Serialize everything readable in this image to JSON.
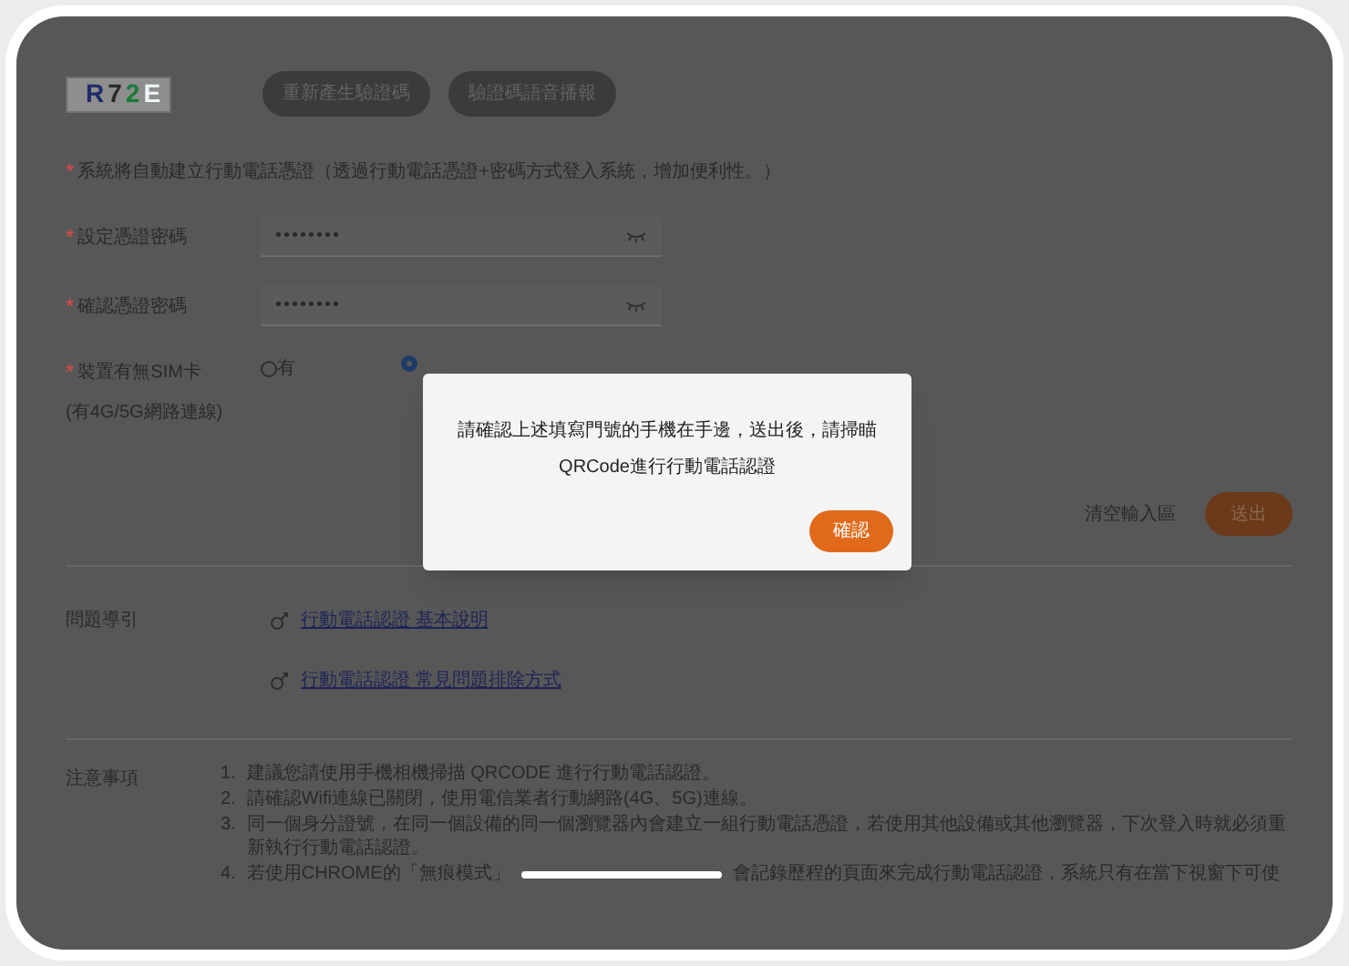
{
  "captcha": {
    "chars": [
      {
        "char": "R",
        "color": "#1f2a6a"
      },
      {
        "char": "7",
        "color": "#2a2a2a"
      },
      {
        "char": "2",
        "color": "#1a7a3a"
      },
      {
        "char": "E",
        "color": "#eef6f8"
      }
    ]
  },
  "captcha_buttons": [
    "重新產生驗證碼",
    "驗證碼語音播報"
  ],
  "notice_marker": "*",
  "notice": "系統將自動建立行動電話憑證（透過行動電話憑證+密碼方式登入系統，增加便利性。）",
  "fields": [
    {
      "marker": "*",
      "label": "設定憑證密碼",
      "value": "••••••••"
    },
    {
      "marker": "*",
      "label": "確認憑證密碼",
      "value": "••••••••"
    }
  ],
  "sim": {
    "marker": "*",
    "label": "裝置有無SIM卡",
    "sublabel": "(有4G/5G網路連線)",
    "options": [
      {
        "label": "有",
        "selected": false
      },
      {
        "selected": true
      }
    ]
  },
  "actions": {
    "clear": "清空輸入區",
    "submit": "送出"
  },
  "guide": {
    "label": "問題導引",
    "links": [
      "行動電話認證 基本說明",
      "行動電話認證 常見問題排除方式"
    ]
  },
  "notes": {
    "label": "注意事項",
    "items": [
      {
        "number": "1.",
        "parts": [
          "建議您請使用手機相機掃描 QRCODE 進行行動電話認證。"
        ]
      },
      {
        "number": "2.",
        "parts": [
          "請確認Wifi連線已關閉，使用電信業者行動網路(4G、5G)連線。"
        ]
      },
      {
        "number": "3.",
        "parts": [
          "同一個身分證號，在同一個設備的同一個瀏覽器內會建立一組行動電話憑證，若使用其他設備或其他瀏覽器，下次登入時就必須重新執行行動電話認證。"
        ]
      },
      {
        "number": "4.",
        "parts": [
          "若使用CHROME的「無痕模式」",
          "會記錄歷程的頁面來完成行動電話認證，系統只有在當下視窗下可使"
        ]
      }
    ]
  },
  "dialog": {
    "message": "請確認上述填寫門號的手機在手邊，送出後，請掃瞄QRCode進行行動電話認證",
    "button": "確認"
  }
}
